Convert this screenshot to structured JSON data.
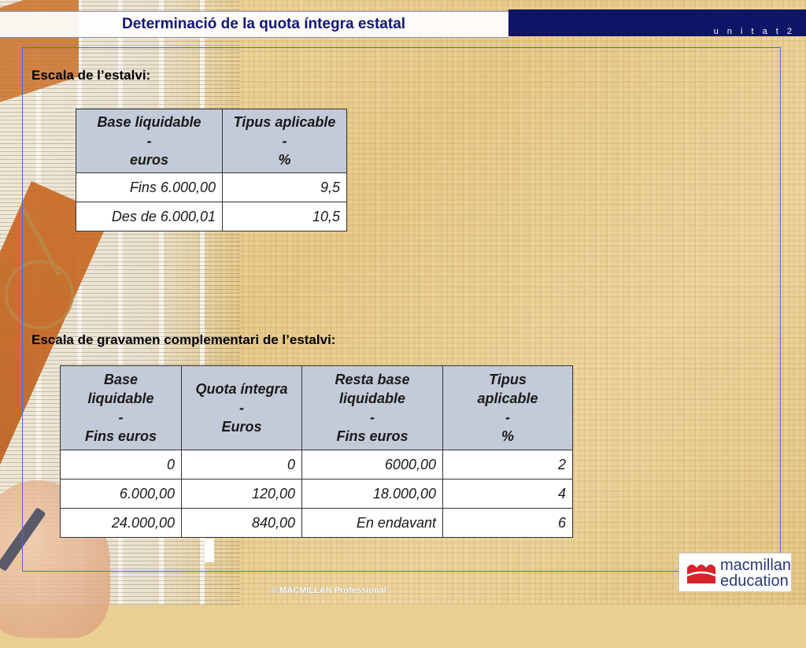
{
  "header": {
    "title": "Determinació de la quota íntegra estatal",
    "unit_label": "u n i t a t  2"
  },
  "savings_scale": {
    "label": "Escala de l’estalvi:",
    "headers": [
      [
        "Base liquidable",
        "-",
        "euros"
      ],
      [
        "Tipus aplicable",
        "-",
        "%"
      ]
    ],
    "rows": [
      [
        "Fins 6.000,00",
        "9,5"
      ],
      [
        "Des de 6.000,01",
        "10,5"
      ]
    ]
  },
  "complementary_scale": {
    "label": "Escala de gravamen complementari de l’estalvi:",
    "headers": [
      [
        "Base",
        "liquidable",
        "-",
        "Fins euros"
      ],
      [
        "Quota íntegra",
        "-",
        "Euros"
      ],
      [
        "Resta base",
        "liquidable",
        "-",
        "Fins euros"
      ],
      [
        "Tipus",
        "aplicable",
        "-",
        "%"
      ]
    ],
    "rows": [
      [
        "0",
        "0",
        "6000,00",
        "2"
      ],
      [
        "6.000,00",
        "120,00",
        "18.000,00",
        "4"
      ],
      [
        "24.000,00",
        "840,00",
        "En endavant",
        "6"
      ]
    ]
  },
  "footer": {
    "copyright": "© MACMILLAN Professional"
  },
  "logo": {
    "line1": "macmillan",
    "line2": "education",
    "mark_icon": "macmillan-m-icon",
    "mark_color": "#d8232a"
  },
  "colors": {
    "header_navy": "#0f1566",
    "title_text": "#14177a",
    "table_header": "#c4cbd8",
    "frame_border": "#4a6ad0"
  }
}
